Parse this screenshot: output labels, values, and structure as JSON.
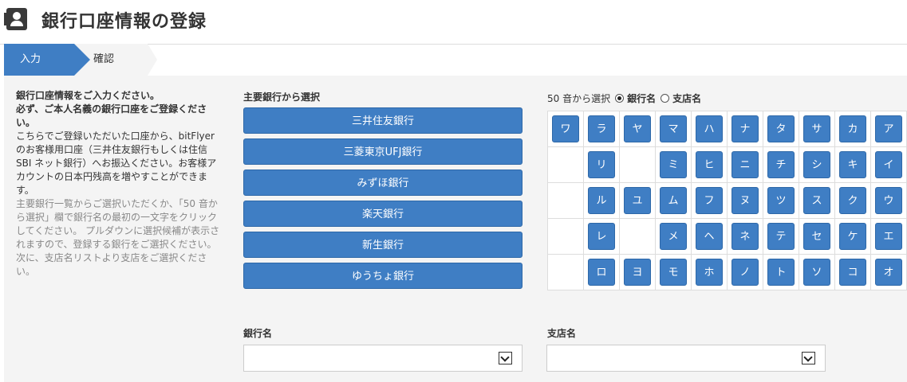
{
  "page": {
    "title": "銀行口座情報の登録",
    "title_icon": "user-badge-icon"
  },
  "steps": [
    "入力",
    "確認"
  ],
  "description": {
    "bold1": "銀行口座情報をご入力ください。",
    "bold2": "必ず、ご本人名義の銀行口座をご登録ください。",
    "normal": "こちらでご登録いただいた口座から、bitFlyer のお客様用口座（三井住友銀行もしくは住信 SBI ネット銀行）へお振込ください。お客様アカウントの日本円残高を増やすことができます。",
    "grey": "主要銀行一覧からご選択いただくか、「50 音から選択」欄で銀行名の最初の一文字をクリックしてください。 プルダウンに選択候補が表示されますので、登録する銀行をご選択ください。 次に、支店名リストより支店をご選択ください。"
  },
  "main_banks": {
    "title": "主要銀行から選択",
    "banks": [
      "三井住友銀行",
      "三菱東京UFJ銀行",
      "みずほ銀行",
      "楽天銀行",
      "新生銀行",
      "ゆうちょ銀行"
    ]
  },
  "kana": {
    "title": "50 音から選択",
    "opt_bank": "銀行名",
    "opt_branch": "支店名",
    "selected": "銀行名",
    "rows": [
      [
        "ワ",
        "ラ",
        "ヤ",
        "マ",
        "ハ",
        "ナ",
        "タ",
        "サ",
        "カ",
        "ア"
      ],
      [
        "",
        "リ",
        "",
        "ミ",
        "ヒ",
        "ニ",
        "チ",
        "シ",
        "キ",
        "イ"
      ],
      [
        "",
        "ル",
        "ユ",
        "ム",
        "フ",
        "ヌ",
        "ツ",
        "ス",
        "ク",
        "ウ"
      ],
      [
        "",
        "レ",
        "",
        "メ",
        "ヘ",
        "ネ",
        "テ",
        "セ",
        "ケ",
        "エ"
      ],
      [
        "",
        "ロ",
        "ヨ",
        "モ",
        "ホ",
        "ノ",
        "ト",
        "ソ",
        "コ",
        "オ"
      ]
    ]
  },
  "form": {
    "bank_label": "銀行名",
    "branch_label": "支店名",
    "bank_value": "",
    "branch_value": ""
  }
}
